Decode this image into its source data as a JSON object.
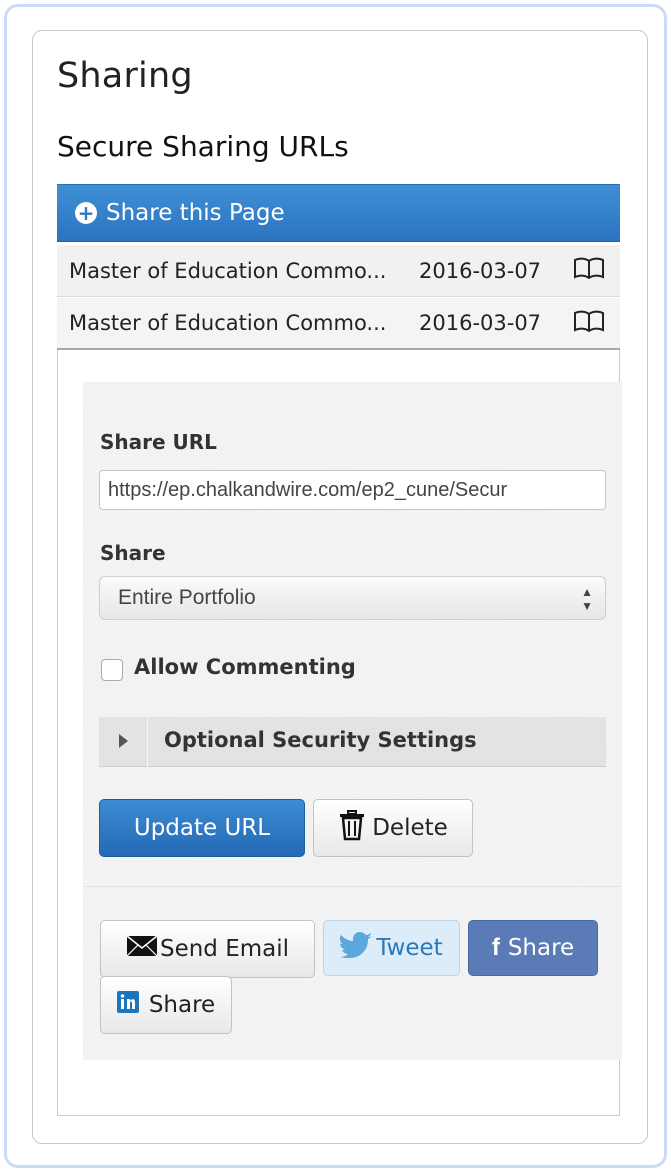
{
  "page_title": "Sharing",
  "section_title": "Secure Sharing URLs",
  "share_bar": {
    "label": "Share this Page",
    "icon": "plus-circle-icon"
  },
  "shared_items": [
    {
      "name": "Master of Education Commo...",
      "date": "2016-03-07",
      "icon": "book-icon"
    },
    {
      "name": "Master of Education Commo...",
      "date": "2016-03-07",
      "icon": "book-icon"
    }
  ],
  "form": {
    "share_url_label": "Share URL",
    "share_url_value": "https://ep.chalkandwire.com/ep2_cune/Secur",
    "share_label": "Share",
    "share_selected": "Entire Portfolio",
    "allow_commenting_label": "Allow Commenting",
    "allow_commenting_checked": false,
    "optional_security_label": "Optional Security Settings",
    "update_button": "Update URL",
    "delete_button": "Delete"
  },
  "social": {
    "email_label": "Send Email",
    "tweet_label": "Tweet",
    "facebook_label": "Share",
    "linkedin_label": "Share"
  },
  "colors": {
    "primary_blue": "#2f7cc6",
    "facebook_blue": "#5b7bb7",
    "twitter_bg": "#dcecf8"
  }
}
